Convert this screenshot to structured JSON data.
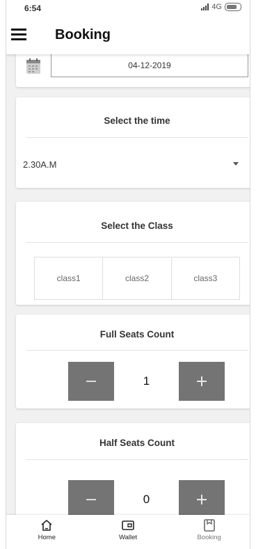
{
  "status_bar": {
    "time": "6:54",
    "network": "4G"
  },
  "app_bar": {
    "title": "Booking"
  },
  "date_card": {
    "date_value": "04-12-2019"
  },
  "time_card": {
    "title": "Select the time",
    "selected_time": "2.30A.M"
  },
  "class_card": {
    "title": "Select the Class",
    "options": [
      "class1",
      "class2",
      "class3"
    ]
  },
  "full_seats": {
    "title": "Full Seats Count",
    "value": "1"
  },
  "half_seats": {
    "title": "Half Seats Count",
    "value": "0"
  },
  "bottom_nav": {
    "items": [
      {
        "label": "Home",
        "icon": "home-icon"
      },
      {
        "label": "Wallet",
        "icon": "wallet-icon"
      },
      {
        "label": "Booking",
        "icon": "booking-icon"
      }
    ]
  },
  "colors": {
    "stepper_button": "#747474",
    "background": "#f1f1f1",
    "card": "#ffffff"
  }
}
